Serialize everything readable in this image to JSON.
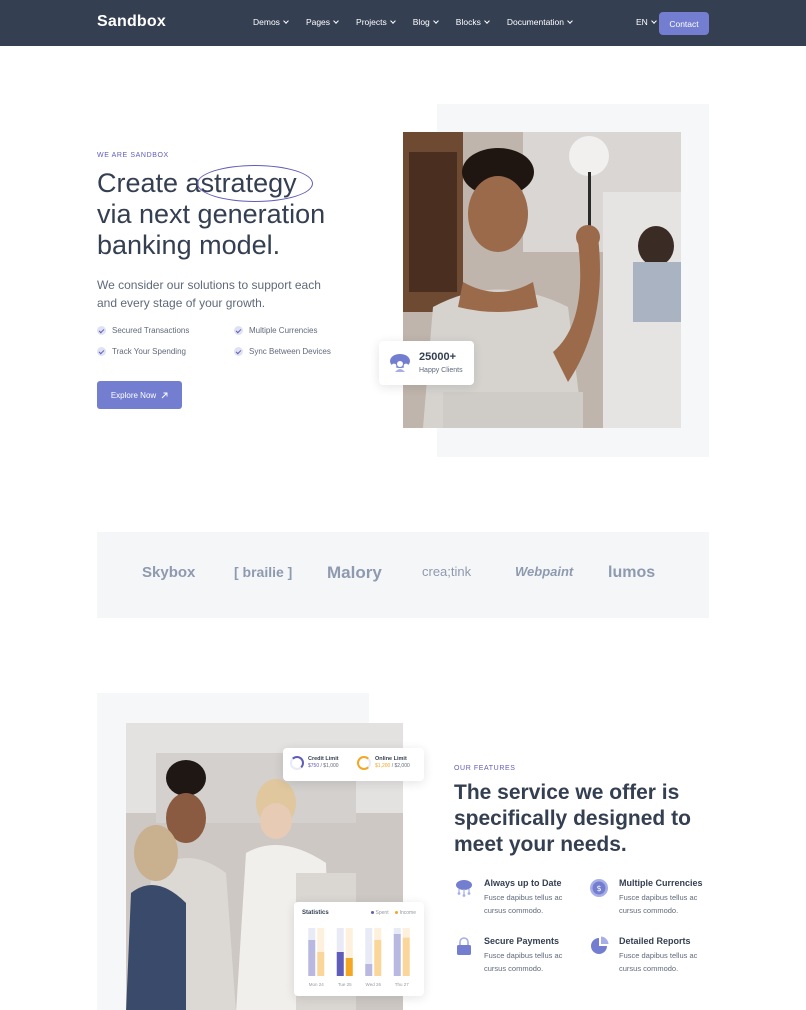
{
  "navbar": {
    "logo": "Sandbox",
    "items": [
      {
        "label": "Demos"
      },
      {
        "label": "Pages"
      },
      {
        "label": "Projects"
      },
      {
        "label": "Blog"
      },
      {
        "label": "Blocks"
      },
      {
        "label": "Documentation"
      }
    ],
    "language": "EN",
    "contact_label": "Contact"
  },
  "hero": {
    "eyebrow": "WE ARE SANDBOX",
    "title_line1_prefix": "Create a",
    "title_highlight": "strategy",
    "title_line2": "via next generation",
    "title_line3": "banking model.",
    "subtitle": "We consider our solutions to support each and every stage of your growth.",
    "checks": [
      "Secured Transactions",
      "Multiple Currencies",
      "Track Your Spending",
      "Sync Between Devices"
    ],
    "cta_label": "Explore Now",
    "clients_count": "25000+",
    "clients_label": "Happy Clients"
  },
  "brands": [
    "Skybox",
    "[ brailie ]",
    "Malory",
    "crea;tink",
    "Webpaint",
    "lumos"
  ],
  "features": {
    "credit": {
      "credit_title": "Credit Limit",
      "credit_used": "$750",
      "credit_total": "/ $1,000",
      "online_title": "Online Limit",
      "online_used": "$1,200",
      "online_total": "/ $2,000"
    },
    "stats": {
      "title": "Statistics",
      "legend_spent": "Spent",
      "legend_income": "Income"
    },
    "eyebrow": "OUR FEATURES",
    "title_lines": [
      "The service we offer is",
      "specifically designed to",
      "meet your needs."
    ],
    "items": [
      {
        "title": "Always up to Date",
        "desc": "Fusce dapibus tellus ac cursus commodo."
      },
      {
        "title": "Multiple Currencies",
        "desc": "Fusce dapibus tellus ac cursus commodo."
      },
      {
        "title": "Secure Payments",
        "desc": "Fusce dapibus tellus ac cursus commodo."
      },
      {
        "title": "Detailed Reports",
        "desc": "Fusce dapibus tellus ac cursus commodo."
      }
    ]
  },
  "chart_data": {
    "type": "bar",
    "title": "Statistics",
    "categories": [
      "Mon 24",
      "Tue 25",
      "Wed 26",
      "Thu 27"
    ],
    "series": [
      {
        "name": "Spent",
        "values": [
          3,
          2,
          1,
          3.5
        ]
      },
      {
        "name": "Income",
        "values": [
          2,
          1.5,
          3,
          3.2
        ]
      }
    ],
    "ylim": [
      0,
      4
    ],
    "colors": {
      "primary": "#747ed1",
      "spent": "#605dba",
      "income": "#f5a623"
    }
  }
}
